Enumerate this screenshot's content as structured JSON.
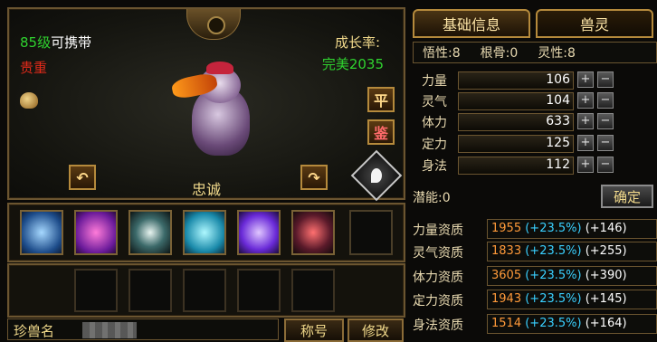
{
  "pet_view": {
    "level_num": "85级",
    "level_text": "可携带",
    "rarity": "贵重",
    "growth_label": "成长率:",
    "growth_value": "完美2035",
    "pet_name": "忠诚",
    "btn_ping": "平",
    "btn_jian": "鉴"
  },
  "name_row": {
    "label": "珍兽名",
    "title_button": "称号",
    "modify_button": "修改"
  },
  "tabs": [
    "基础信息",
    "兽灵"
  ],
  "attributes": [
    {
      "label": "悟性:8"
    },
    {
      "label": "根骨:0"
    },
    {
      "label": "灵性:8"
    }
  ],
  "stats": [
    {
      "label": "力量",
      "value": "106"
    },
    {
      "label": "灵气",
      "value": "104"
    },
    {
      "label": "体力",
      "value": "633"
    },
    {
      "label": "定力",
      "value": "125"
    },
    {
      "label": "身法",
      "value": "112"
    }
  ],
  "potential": "潜能:0",
  "confirm_button": "确定",
  "aptitudes": [
    {
      "label": "力量资质",
      "base": "1955",
      "pct": "(+23.5%)",
      "bonus": "(+146)"
    },
    {
      "label": "灵气资质",
      "base": "1833",
      "pct": "(+23.5%)",
      "bonus": "(+255)"
    },
    {
      "label": "体力资质",
      "base": "3605",
      "pct": "(+23.5%)",
      "bonus": "(+390)"
    },
    {
      "label": "定力资质",
      "base": "1943",
      "pct": "(+23.5%)",
      "bonus": "(+145)"
    },
    {
      "label": "身法资质",
      "base": "1514",
      "pct": "(+23.5%)",
      "bonus": "(+164)"
    }
  ],
  "colors": {
    "gold": "#f1d98b",
    "green": "#2fd22f",
    "red": "#e02a1a",
    "orange": "#ff9a3a",
    "cyan": "#3ad0ff"
  }
}
